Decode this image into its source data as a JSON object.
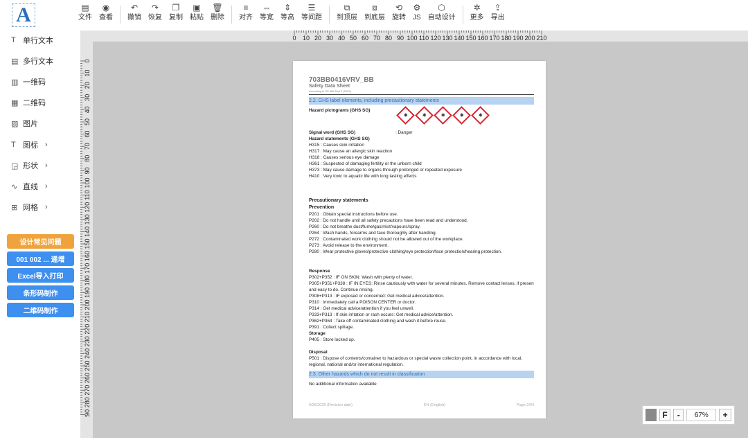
{
  "toolbar": [
    {
      "icon": "file-icon",
      "glyph": "▤",
      "label": "文件"
    },
    {
      "icon": "view-icon",
      "glyph": "◉",
      "label": "查看"
    },
    {
      "sep": true
    },
    {
      "icon": "undo-icon",
      "glyph": "↶",
      "label": "撤销"
    },
    {
      "icon": "redo-icon",
      "glyph": "↷",
      "label": "恢复"
    },
    {
      "icon": "copy-icon",
      "glyph": "❐",
      "label": "复制"
    },
    {
      "icon": "paste-icon",
      "glyph": "▣",
      "label": "粘贴"
    },
    {
      "icon": "delete-icon",
      "glyph": "🗑",
      "label": "删除"
    },
    {
      "sep": true
    },
    {
      "icon": "align-icon",
      "glyph": "≡",
      "label": "对齐"
    },
    {
      "icon": "equal-width-icon",
      "glyph": "⇔",
      "label": "等宽"
    },
    {
      "icon": "equal-height-icon",
      "glyph": "⇕",
      "label": "等高"
    },
    {
      "icon": "equal-spacing-icon",
      "glyph": "☰",
      "label": "等间距"
    },
    {
      "sep": true
    },
    {
      "icon": "bring-to-top-icon",
      "glyph": "⧉",
      "label": "到顶层"
    },
    {
      "icon": "send-to-bottom-icon",
      "glyph": "⧈",
      "label": "到底层"
    },
    {
      "icon": "rotate-icon",
      "glyph": "⟲",
      "label": "旋转"
    },
    {
      "icon": "js-icon",
      "glyph": "⚙",
      "label": "JS"
    },
    {
      "icon": "auto-design-icon",
      "glyph": "⬡",
      "label": "自动设计"
    },
    {
      "sep": true
    },
    {
      "icon": "more-icon",
      "glyph": "✲",
      "label": "更多"
    },
    {
      "icon": "export-icon",
      "glyph": "⇪",
      "label": "导出"
    }
  ],
  "logo": {
    "letter": "A"
  },
  "sidebar": {
    "items": [
      {
        "glyph": "T",
        "label": "单行文本",
        "arrow": ""
      },
      {
        "glyph": "▤",
        "label": "多行文本",
        "arrow": ""
      },
      {
        "glyph": "▥",
        "label": "一维码",
        "arrow": ""
      },
      {
        "glyph": "▦",
        "label": "二维码",
        "arrow": ""
      },
      {
        "glyph": "▨",
        "label": "图片",
        "arrow": ""
      },
      {
        "glyph": "T",
        "label": "图标",
        "arrow": "›"
      },
      {
        "glyph": "◲",
        "label": "形状",
        "arrow": "›"
      },
      {
        "glyph": "∿",
        "label": "直线",
        "arrow": "›"
      },
      {
        "glyph": "⊞",
        "label": "网格",
        "arrow": "›"
      }
    ],
    "buttons": [
      {
        "label": "设计常见问题",
        "style": "orange"
      },
      {
        "label": "001 002 ... 递增",
        "style": "blue"
      },
      {
        "label": "Excel导入打印",
        "style": "blue"
      },
      {
        "label": "条形码制作",
        "style": "blue"
      },
      {
        "label": "二维码制作",
        "style": "blue"
      }
    ]
  },
  "ruler": {
    "top_ticks": [
      "0",
      "10",
      "20",
      "30",
      "40",
      "50",
      "60",
      "70",
      "80",
      "90",
      "100",
      "110",
      "120",
      "130",
      "140",
      "150",
      "160",
      "170",
      "180",
      "190",
      "200",
      "210"
    ],
    "left_ticks": [
      "0",
      "10",
      "20",
      "30",
      "40",
      "50",
      "60",
      "70",
      "80",
      "90",
      "100",
      "110",
      "120",
      "130",
      "140",
      "150",
      "160",
      "170",
      "180",
      "190",
      "200",
      "210",
      "220",
      "230",
      "240",
      "250",
      "260",
      "270",
      "280",
      "290"
    ]
  },
  "document": {
    "title": "703BB0416VRV_BB",
    "subtitle": "Safety Data Sheet",
    "subtitle2": "According to SS 586 Part 3 (2022)",
    "section_22": "2.2. GHS label elements, including precautionary statements",
    "pictograms_label": "Hazard pictograms (GHS SG)",
    "pictograms": [
      "GHS08",
      "GHS08",
      "GHS08",
      "GHS08",
      "GHS08"
    ],
    "signal_word_label": "Signal word (GHS SG)",
    "signal_word_value": ":  Danger",
    "hazard_statements_label": "Hazard statements (GHS SG)",
    "hazard_statements": [
      "H315 : Causes skin irritation",
      "H317 : May cause an allergic skin reaction",
      "H318 : Causes serious eye damage",
      "H361 : Suspected of damaging fertility or the unborn child",
      "H373 : May cause damage to organs through prolonged or repeated exposure",
      "H410 : Very toxic to aquatic life with long lasting effects"
    ],
    "precautionary_label": "Precautionary statements",
    "prevention_label": "Prevention",
    "prevention": [
      "P201 : Obtain special instructions before use.",
      "P202 : Do not handle until all safety precautions have been read and understood.",
      "P260 : Do not breathe dust/fume/gas/mist/vapours/spray.",
      "P264 : Wash hands, forearms and face thoroughly after handling.",
      "P272 : Contaminated work clothing should not be allowed out of the workplace.",
      "P273 : Avoid release to the environment.",
      "P280 : Wear protective gloves/protective clothing/eye protection/face protection/hearing protection."
    ],
    "response_label": "Response",
    "response": [
      "P302+P352 : IF ON SKIN: Wash with plenty of water.",
      "P305+P351+P338 : IF IN EYES: Rinse cautiously with water for several minutes. Remove contact lenses, if present",
      "and easy to do. Continue rinsing.",
      "P308+P313 : IF exposed or concerned: Get medical advice/attention.",
      "P310 : Immediately call a POISON CENTER or doctor.",
      "P314 : Get medical advice/attention if you feel unwell.",
      "P333+P313 : If skin irritation or rash occurs: Get medical advice/attention.",
      "P362+P364 : Take off contaminated clothing and wash it before reuse.",
      "P391 : Collect spillage."
    ],
    "storage_label": "Storage",
    "storage": [
      "P405 : Store locked up."
    ],
    "disposal_label": "Disposal",
    "disposal": [
      "P501 : Dispose of contents/container to hazardous or special waste collection point, in accordance with local,",
      "regional, national and/or international regulation."
    ],
    "section_23": "2.3. Other hazards which do not result in classification",
    "other_hazards": "No additional information available",
    "footer_left": "6/25/2025 (Revision date)",
    "footer_mid": "EN (English)",
    "footer_right": "Page 2/34"
  },
  "zoom": {
    "f_label": "F",
    "minus": "-",
    "value": "67%",
    "plus": "+",
    "color": "#8a8a8a"
  }
}
